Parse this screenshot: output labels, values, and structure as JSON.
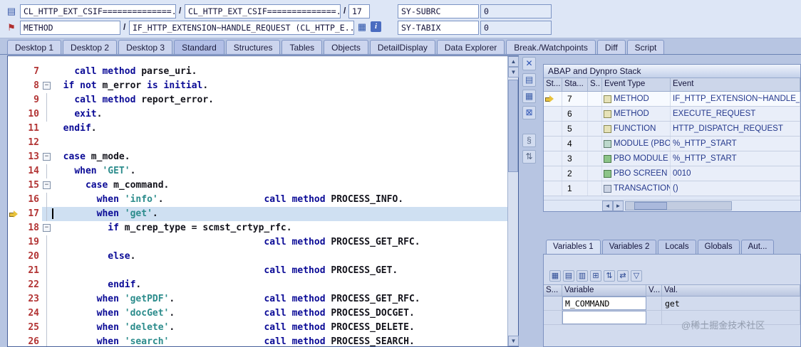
{
  "topbar": {
    "row1": {
      "program_field": "CL_HTTP_EXT_CSIF==============...",
      "separator1": "/",
      "include_field": "CL_HTTP_EXT_CSIF==============...",
      "separator2": "/",
      "line_field": "17",
      "sy_subrc_label": "SY-SUBRC",
      "sy_subrc_value": "0"
    },
    "row2": {
      "event_type_field": "METHOD",
      "separator": "/",
      "event_field": "IF_HTTP_EXTENSION~HANDLE_REQUEST (CL_HTTP_E...",
      "sy_tabix_label": "SY-TABIX",
      "sy_tabix_value": "0"
    }
  },
  "topbar_icons": {
    "row1_leading": "▤",
    "row2_leading": "⚑",
    "grid": "▦",
    "info": "i"
  },
  "scrollbars": {
    "up": "▲",
    "down": "▼",
    "left": "◄",
    "right": "►"
  },
  "main_tabs": [
    {
      "label": "Desktop 1",
      "active": false
    },
    {
      "label": "Desktop 2",
      "active": false
    },
    {
      "label": "Desktop 3",
      "active": false
    },
    {
      "label": "Standard",
      "active": true
    },
    {
      "label": "Structures",
      "active": false
    },
    {
      "label": "Tables",
      "active": false
    },
    {
      "label": "Objects",
      "active": false
    },
    {
      "label": "DetailDisplay",
      "active": false
    },
    {
      "label": "Data Explorer",
      "active": false
    },
    {
      "label": "Break./Watchpoints",
      "active": false
    },
    {
      "label": "Diff",
      "active": false
    },
    {
      "label": "Script",
      "active": false
    }
  ],
  "editor": {
    "current_line": "17",
    "fold_collapse_glyph": "−",
    "lines": [
      {
        "num": "7",
        "fold": "",
        "tokens": [
          [
            "    ",
            "n"
          ],
          [
            "call method ",
            "k"
          ],
          [
            "parse_uri.",
            "n"
          ]
        ]
      },
      {
        "num": "8",
        "fold": "box",
        "tokens": [
          [
            "  ",
            "n"
          ],
          [
            "if not ",
            "k"
          ],
          [
            "m_error ",
            "n"
          ],
          [
            "is initial",
            "k"
          ],
          [
            ".",
            "n"
          ]
        ]
      },
      {
        "num": "9",
        "fold": "line",
        "tokens": [
          [
            "    ",
            "n"
          ],
          [
            "call method ",
            "k"
          ],
          [
            "report_error.",
            "n"
          ]
        ]
      },
      {
        "num": "10",
        "fold": "line",
        "tokens": [
          [
            "    ",
            "n"
          ],
          [
            "exit",
            "k"
          ],
          [
            ".",
            "n"
          ]
        ]
      },
      {
        "num": "11",
        "fold": "",
        "tokens": [
          [
            "  ",
            "n"
          ],
          [
            "endif",
            "k"
          ],
          [
            ".",
            "n"
          ]
        ]
      },
      {
        "num": "12",
        "fold": "",
        "tokens": []
      },
      {
        "num": "13",
        "fold": "box",
        "tokens": [
          [
            "  ",
            "n"
          ],
          [
            "case ",
            "k"
          ],
          [
            "m_mode.",
            "n"
          ]
        ]
      },
      {
        "num": "14",
        "fold": "line",
        "tokens": [
          [
            "    ",
            "n"
          ],
          [
            "when ",
            "k"
          ],
          [
            "'GET'",
            "s"
          ],
          [
            ".",
            "n"
          ]
        ]
      },
      {
        "num": "15",
        "fold": "box",
        "tokens": [
          [
            "      ",
            "n"
          ],
          [
            "case ",
            "k"
          ],
          [
            "m_command.",
            "n"
          ]
        ]
      },
      {
        "num": "16",
        "fold": "line",
        "tokens": [
          [
            "        ",
            "n"
          ],
          [
            "when ",
            "k"
          ],
          [
            "'info'",
            "s"
          ],
          [
            ".                  ",
            "n"
          ],
          [
            "call method ",
            "k"
          ],
          [
            "PROCESS_INFO.",
            "n"
          ]
        ]
      },
      {
        "num": "17",
        "fold": "line",
        "tokens": [
          [
            "        ",
            "n"
          ],
          [
            "when ",
            "k"
          ],
          [
            "'get'",
            "s"
          ],
          [
            ".",
            "n"
          ]
        ]
      },
      {
        "num": "18",
        "fold": "box",
        "tokens": [
          [
            "          ",
            "n"
          ],
          [
            "if ",
            "k"
          ],
          [
            "m_crep_type = scmst_crtyp_rfc.",
            "n"
          ]
        ]
      },
      {
        "num": "19",
        "fold": "line",
        "tokens": [
          [
            "                                      ",
            "n"
          ],
          [
            "call method ",
            "k"
          ],
          [
            "PROCESS_GET_RFC.",
            "n"
          ]
        ]
      },
      {
        "num": "20",
        "fold": "line",
        "tokens": [
          [
            "          ",
            "n"
          ],
          [
            "else",
            "k"
          ],
          [
            ".",
            "n"
          ]
        ]
      },
      {
        "num": "21",
        "fold": "line",
        "tokens": [
          [
            "                                      ",
            "n"
          ],
          [
            "call method ",
            "k"
          ],
          [
            "PROCESS_GET.",
            "n"
          ]
        ]
      },
      {
        "num": "22",
        "fold": "line",
        "tokens": [
          [
            "          ",
            "n"
          ],
          [
            "endif",
            "k"
          ],
          [
            ".",
            "n"
          ]
        ]
      },
      {
        "num": "23",
        "fold": "line",
        "tokens": [
          [
            "        ",
            "n"
          ],
          [
            "when ",
            "k"
          ],
          [
            "'getPDF'",
            "s"
          ],
          [
            ".                ",
            "n"
          ],
          [
            "call method ",
            "k"
          ],
          [
            "PROCESS_GET_RFC.",
            "n"
          ]
        ]
      },
      {
        "num": "24",
        "fold": "line",
        "tokens": [
          [
            "        ",
            "n"
          ],
          [
            "when ",
            "k"
          ],
          [
            "'docGet'",
            "s"
          ],
          [
            ".                ",
            "n"
          ],
          [
            "call method ",
            "k"
          ],
          [
            "PROCESS_DOCGET.",
            "n"
          ]
        ]
      },
      {
        "num": "25",
        "fold": "line",
        "tokens": [
          [
            "        ",
            "n"
          ],
          [
            "when ",
            "k"
          ],
          [
            "'delete'",
            "s"
          ],
          [
            ".                ",
            "n"
          ],
          [
            "call method ",
            "k"
          ],
          [
            "PROCESS_DELETE.",
            "n"
          ]
        ]
      },
      {
        "num": "26",
        "fold": "line",
        "tokens": [
          [
            "        ",
            "n"
          ],
          [
            "when ",
            "k"
          ],
          [
            "'search'",
            "s"
          ],
          [
            "                 ",
            "n"
          ],
          [
            "call method ",
            "k"
          ],
          [
            "PROCESS_SEARCH.",
            "n"
          ]
        ]
      }
    ]
  },
  "editor_tools": [
    {
      "name": "close",
      "glyph": "✕",
      "color": "#2f55b4",
      "gap": false
    },
    {
      "name": "new-page",
      "glyph": "▤",
      "color": "#3a5ca8",
      "gap": false
    },
    {
      "name": "copy-page",
      "glyph": "▦",
      "color": "#3a5ca8",
      "gap": false
    },
    {
      "name": "select-block",
      "glyph": "⊠",
      "color": "#2f55b4",
      "gap": false
    },
    {
      "name": "link",
      "glyph": "§",
      "color": "#5a6a88",
      "gap": true
    },
    {
      "name": "sort",
      "glyph": "⇅",
      "color": "#5a6a88",
      "gap": false
    }
  ],
  "stack_panel": {
    "title": "ABAP and Dynpro Stack",
    "columns": [
      "St...",
      "Sta...",
      "S..",
      "Event Type",
      "Event"
    ],
    "rows": [
      {
        "current": true,
        "level": "7",
        "icon": "method",
        "event_type": "METHOD",
        "event": "IF_HTTP_EXTENSION~HANDLE_REQUEST"
      },
      {
        "current": false,
        "level": "6",
        "icon": "method",
        "event_type": "METHOD",
        "event": "EXECUTE_REQUEST"
      },
      {
        "current": false,
        "level": "5",
        "icon": "function",
        "event_type": "FUNCTION",
        "event": "HTTP_DISPATCH_REQUEST"
      },
      {
        "current": false,
        "level": "4",
        "icon": "module",
        "event_type": "MODULE (PBO)",
        "event": "%_HTTP_START"
      },
      {
        "current": false,
        "level": "3",
        "icon": "screen",
        "event_type": "PBO MODULE",
        "event": "%_HTTP_START"
      },
      {
        "current": false,
        "level": "2",
        "icon": "screen",
        "event_type": "PBO SCREEN",
        "event": "0010"
      },
      {
        "current": false,
        "level": "1",
        "icon": "transaction",
        "event_type": "TRANSACTION",
        "event": "()"
      }
    ]
  },
  "variables_panel": {
    "tabs": [
      {
        "label": "Variables 1",
        "active": true
      },
      {
        "label": "Variables 2",
        "active": false
      },
      {
        "label": "Locals",
        "active": false
      },
      {
        "label": "Globals",
        "active": false
      },
      {
        "label": "Aut...",
        "active": false
      }
    ],
    "toolbar_icons": [
      {
        "name": "trash",
        "glyph": "▦"
      },
      {
        "name": "table",
        "glyph": "▤"
      },
      {
        "name": "table-display",
        "glyph": "▥"
      },
      {
        "name": "table-insert",
        "glyph": "⊞"
      },
      {
        "name": "sort-swap",
        "glyph": "⇅"
      },
      {
        "name": "transfer",
        "glyph": "⇄"
      },
      {
        "name": "filter",
        "glyph": "▽"
      }
    ],
    "columns": [
      "S...",
      "Variable",
      "V...",
      "Val."
    ],
    "rows": [
      {
        "variable": "M_COMMAND",
        "value": "get"
      },
      {
        "variable": "",
        "value": ""
      }
    ]
  },
  "watermark": "@稀土掘金技术社区"
}
